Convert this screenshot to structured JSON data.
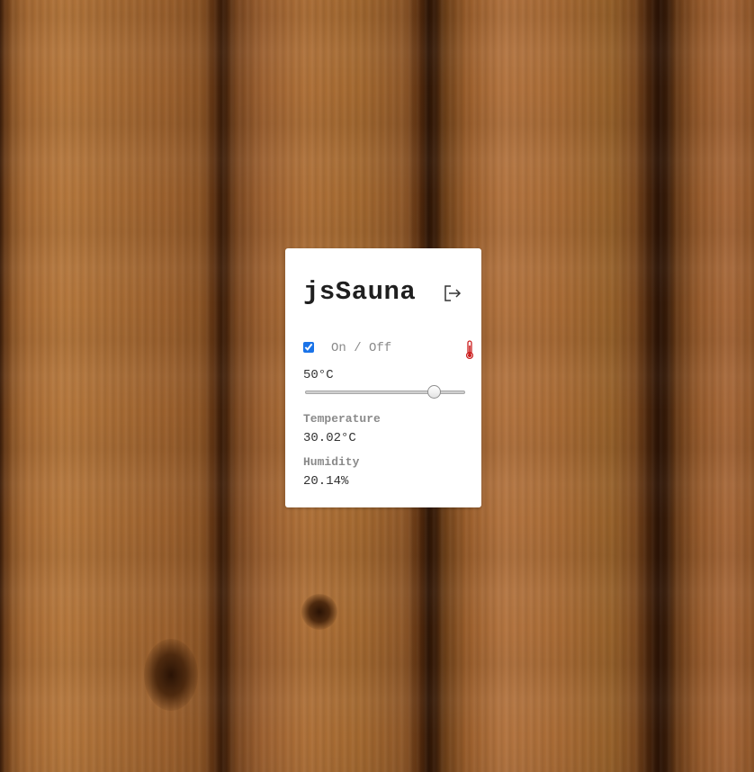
{
  "app": {
    "title": "jsSauna"
  },
  "header": {
    "logout_icon": "logout-icon"
  },
  "power": {
    "checked": true,
    "label": "On / Off",
    "status_icon": "thermometer-icon",
    "status_color": "#cc1f1f"
  },
  "setpoint": {
    "label": "50°C",
    "value": 50,
    "min": 0,
    "max": 60
  },
  "temperature": {
    "label": "Temperature",
    "value": "30.02°C"
  },
  "humidity": {
    "label": "Humidity",
    "value": "20.14%"
  },
  "colors": {
    "card_bg": "#ffffff",
    "accent": "#1a73e8"
  }
}
